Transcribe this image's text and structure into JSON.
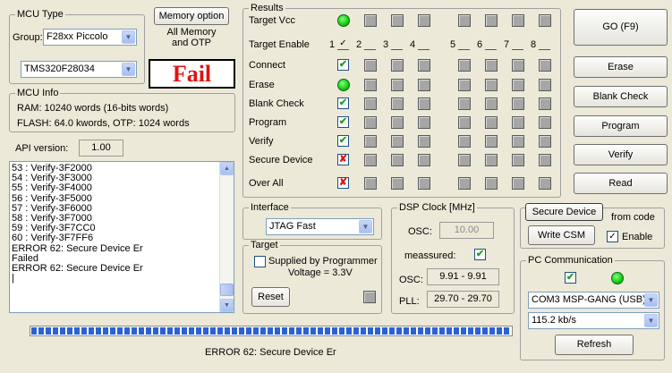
{
  "mcu_type": {
    "title": "MCU Type",
    "group_label": "Group:",
    "group_value": "F28xx Piccolo",
    "device_value": "TMS320F28034",
    "memory_option_label": "Memory option",
    "memory_option_text_1": "All Memory",
    "memory_option_text_2": "and OTP",
    "status": "Fail",
    "status_color": "#e21212"
  },
  "mcu_info": {
    "title": "MCU Info",
    "ram": "RAM: 10240 words (16-bits words)",
    "flash": "FLASH:  64.0 kwords,  OTP: 1024 words"
  },
  "api_version": {
    "label": "API version:",
    "value": "1.00"
  },
  "log": {
    "lines": [
      "53 : Verify-3F2000",
      "54 : Verify-3F3000",
      "55 : Verify-3F4000",
      "56 : Verify-3F5000",
      "57 : Verify-3F6000",
      "58 : Verify-3F7000",
      "59 : Verify-3F7CC0",
      "60 : Verify-3F7FF6",
      "ERROR 62: Secure Device Er",
      "Failed",
      "ERROR 62: Secure Device Er",
      "|"
    ]
  },
  "results": {
    "title": "Results",
    "rows": [
      "Target Vcc",
      "Target Enable",
      "Connect",
      "Erase",
      "Blank Check",
      "Program",
      "Verify",
      "Secure Device",
      "Over All"
    ],
    "target_numbers": [
      "1",
      "2",
      "3",
      "4",
      "5",
      "6",
      "7",
      "8"
    ],
    "target1_checked": "✓",
    "first_column_status": [
      "led",
      "checkbox",
      "ok",
      "led",
      "ok",
      "ok",
      "ok",
      "bad",
      "bad"
    ],
    "ok_mark": "✔",
    "bad_mark": "✘"
  },
  "actions": {
    "go": "GO    (F9)",
    "erase": "Erase",
    "blank_check": "Blank Check",
    "program": "Program",
    "verify": "Verify",
    "read": "Read"
  },
  "interface": {
    "title": "Interface",
    "value": "JTAG Fast"
  },
  "target": {
    "title": "Target",
    "supplied_label": "Supplied by Programmer",
    "voltage": "Voltage = 3.3V",
    "reset_label": "Reset"
  },
  "dsp_clock": {
    "title": "DSP Clock [MHz]",
    "osc_label": "OSC:",
    "osc_value": "10.00",
    "measured_label": "meassured:",
    "measured_mark": "✔",
    "osc2_label": "OSC:",
    "osc2_value": "9.91 - 9.91",
    "pll_label": "PLL:",
    "pll_value": "29.70 - 29.70"
  },
  "secure": {
    "secure_device_label": "Secure Device",
    "from_code_label": "from code",
    "write_csm_label": "Write CSM",
    "enable_label": "Enable",
    "enable_mark": "✓"
  },
  "pc_comm": {
    "title": "PC Communication",
    "tx_mark": "✔",
    "port_value": "COM3   MSP-GANG (USB)",
    "baud_value": "115.2 kb/s",
    "refresh_label": "Refresh"
  },
  "status_bar": {
    "message": "ERROR 62: Secure Device Er",
    "progress": 1.0
  }
}
